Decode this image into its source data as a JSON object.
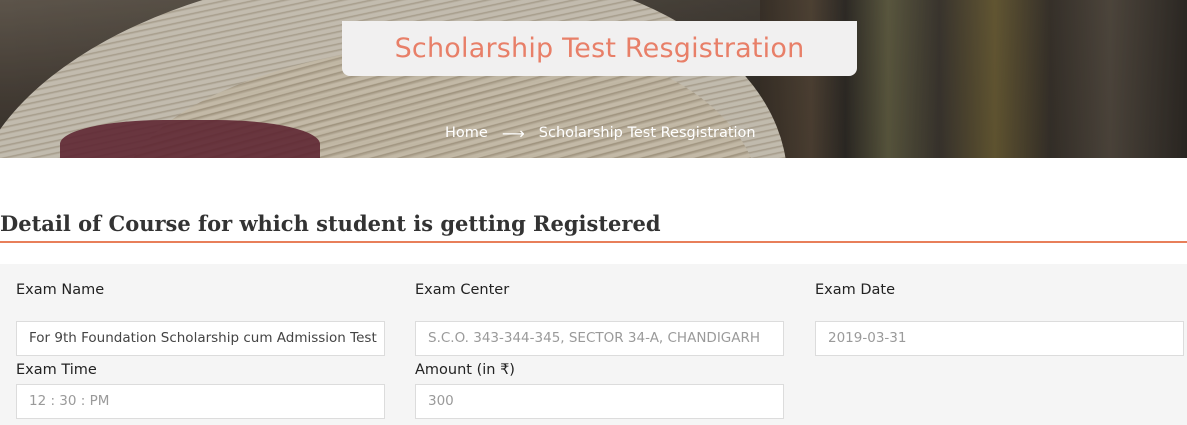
{
  "banner": {
    "title": "Scholarship Test Resgistration",
    "breadcrumb": {
      "home": "Home",
      "separator": "⟶",
      "current": "Scholarship Test Resgistration"
    }
  },
  "section": {
    "title": "Detail of Course for which student is getting Registered"
  },
  "form": {
    "exam_name": {
      "label": "Exam Name",
      "value": "For 9th Foundation Scholarship cum Admission Test"
    },
    "exam_center": {
      "label": "Exam Center",
      "value": "S.C.O. 343-344-345, SECTOR 34-A, CHANDIGARH"
    },
    "exam_date": {
      "label": "Exam Date",
      "value": "2019-03-31"
    },
    "exam_time": {
      "label": "Exam Time",
      "value": "12 : 30 : PM"
    },
    "amount": {
      "label": "Amount (in ₹)",
      "value": "300"
    }
  },
  "colors": {
    "accent": "#e87f68",
    "rule": "#e87f5a",
    "panel": "#f5f5f5"
  }
}
